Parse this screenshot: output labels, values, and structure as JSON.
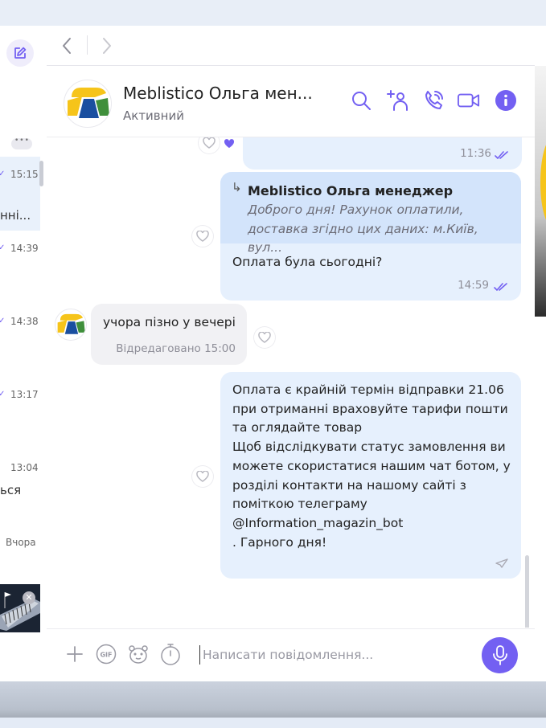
{
  "left_panel": {
    "chat_times": [
      "15:15",
      "14:39",
      "14:38",
      "13:17",
      "13:04"
    ],
    "snippet_1": "нні...",
    "snippet_2": "ься",
    "yesterday_label": "Вчора"
  },
  "header": {
    "contact_name": "Meblistico Ольга мен...",
    "status": "Активний"
  },
  "messages": {
    "m1": {
      "time": "11:36"
    },
    "m2": {
      "reply_to_name": "Meblistico Ольга менеджер",
      "reply_to_text": "Доброго дня! Рахунок оплатили, доставка згідно цих даних: м.Київ, вул...",
      "text": "Оплата була сьогодні?",
      "time": "14:59"
    },
    "m3": {
      "text": "учора пізно у вечері",
      "edited_label": "Відредаговано 15:00"
    },
    "m4": {
      "lines": [
        "Оплата є крайній термін відправки 21.06",
        "при отриманні враховуйте тарифи пошти",
        "та оглядайте товар",
        "Щоб відслідкувати статус замовлення ви",
        "можете скористатися нашим чат ботом, у",
        "розділі контакти на нашому сайті з",
        "поміткою телеграму",
        "@Information_magazin_bot",
        ". Гарного дня!"
      ]
    }
  },
  "input": {
    "placeholder": "Написати повідомлення..."
  },
  "colors": {
    "accent": "#7360f2",
    "outgoing_bubble": "#e6f0fd",
    "incoming_bubble": "#f1f1f4",
    "quote_bg": "#d3e4fb"
  },
  "icons": {
    "compose": "compose-icon",
    "back": "chevron-left-icon",
    "forward": "chevron-right-icon",
    "search": "search-icon",
    "add_participant": "add-participant-icon",
    "call": "phone-icon",
    "video": "video-icon",
    "info": "info-icon",
    "attach": "plus-icon",
    "gif": "gif-icon",
    "sticker": "sticker-icon",
    "timer": "timer-icon",
    "mic": "mic-icon",
    "heart": "heart-icon"
  }
}
